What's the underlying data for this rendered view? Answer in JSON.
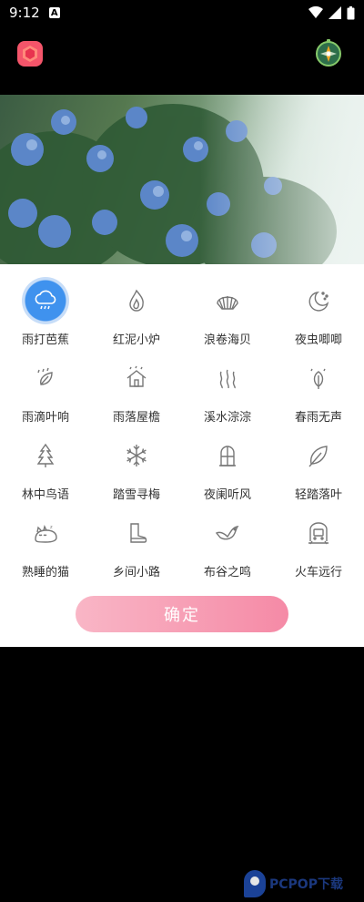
{
  "status": {
    "time": "9:12",
    "notif_letter": "A"
  },
  "colors": {
    "accent": "#3f92ee",
    "confirm_start": "#f9b6c6",
    "confirm_end": "#f58aa6"
  },
  "sounds": [
    {
      "label": "雨打芭蕉",
      "icon": "cloud-rain-icon",
      "selected": true
    },
    {
      "label": "红泥小炉",
      "icon": "flame-icon"
    },
    {
      "label": "浪卷海贝",
      "icon": "shell-icon"
    },
    {
      "label": "夜虫唧唧",
      "icon": "moon-icon"
    },
    {
      "label": "雨滴叶响",
      "icon": "rain-leaf-icon"
    },
    {
      "label": "雨落屋檐",
      "icon": "house-rain-icon"
    },
    {
      "label": "溪水淙淙",
      "icon": "stream-icon"
    },
    {
      "label": "春雨无声",
      "icon": "spring-rain-icon"
    },
    {
      "label": "林中鸟语",
      "icon": "pine-tree-icon"
    },
    {
      "label": "踏雪寻梅",
      "icon": "snowflake-icon"
    },
    {
      "label": "夜阑听风",
      "icon": "window-icon"
    },
    {
      "label": "轻踏落叶",
      "icon": "leaf-icon"
    },
    {
      "label": "熟睡的猫",
      "icon": "cat-icon"
    },
    {
      "label": "乡间小路",
      "icon": "boot-icon"
    },
    {
      "label": "布谷之鸣",
      "icon": "bird-icon"
    },
    {
      "label": "火车远行",
      "icon": "train-icon"
    }
  ],
  "confirm_label": "确定",
  "watermark": "PCPOP下载"
}
